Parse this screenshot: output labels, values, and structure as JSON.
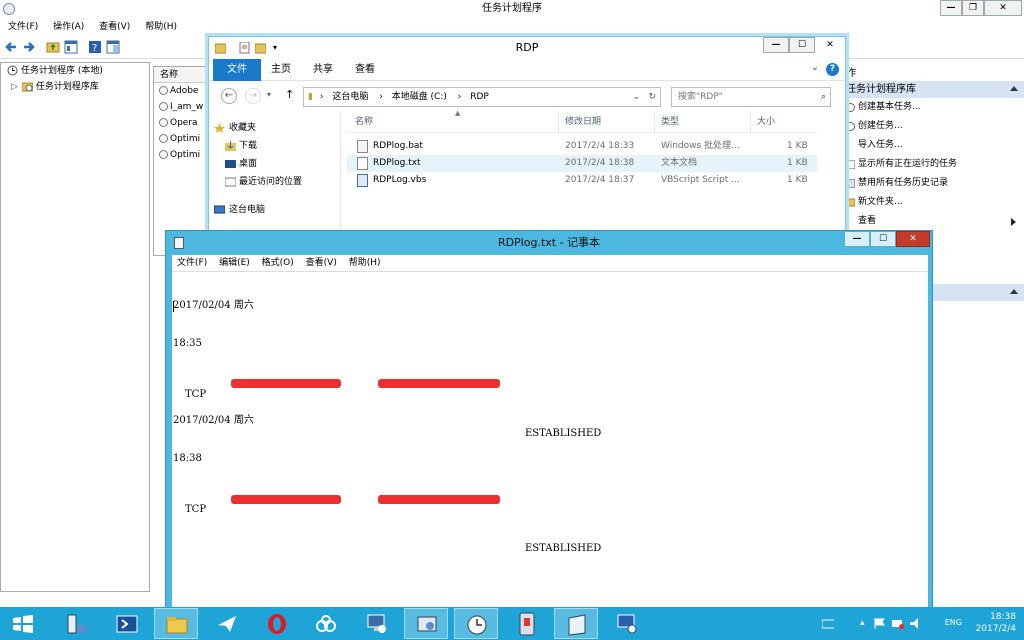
{
  "task_scheduler": {
    "title": "任务计划程序",
    "menu": [
      "文件(F)",
      "操作(A)",
      "查看(V)",
      "帮助(H)"
    ],
    "tree": {
      "root": "任务计划程序 (本地)",
      "library": "任务计划程序库"
    },
    "list": {
      "header": "名称",
      "items": [
        "Adobe",
        "I_am_w",
        "Opera",
        "Optimi",
        "Optimi"
      ]
    },
    "actions": {
      "header": "作",
      "section": "任务计划程序库",
      "items": [
        "创建基本任务...",
        "创建任务...",
        "导入任务...",
        "显示所有正在运行的任务",
        "禁用所有任务历史记录",
        "新文件夹...",
        "查看"
      ]
    }
  },
  "explorer": {
    "title": "RDP",
    "ribbon_tabs": [
      "文件",
      "主页",
      "共享",
      "查看"
    ],
    "address": [
      "这台电脑",
      "本地磁盘 (C:)",
      "RDP"
    ],
    "search_placeholder": "搜索\"RDP\"",
    "nav": [
      "收藏夹",
      "下载",
      "桌面",
      "最近访问的位置",
      "这台电脑"
    ],
    "columns": [
      "名称",
      "修改日期",
      "类型",
      "大小"
    ],
    "files": [
      {
        "name": "RDPlog.bat",
        "date": "2017/2/4 18:33",
        "type": "Windows 批处理...",
        "size": "1 KB"
      },
      {
        "name": "RDPlog.txt",
        "date": "2017/2/4 18:38",
        "type": "文本文档",
        "size": "1 KB"
      },
      {
        "name": "RDPLog.vbs",
        "date": "2017/2/4 18:37",
        "type": "VBScript Script ...",
        "size": "1 KB"
      }
    ]
  },
  "notepad": {
    "title": "RDPlog.txt - 记事本",
    "menu": [
      "文件(F)",
      "编辑(E)",
      "格式(O)",
      "查看(V)",
      "帮助(H)"
    ],
    "lines": [
      {
        "date": "2017/02/04 周六",
        "time": "18:35",
        "proto": "TCP",
        "state": "ESTABLISHED"
      },
      {
        "date": "2017/02/04 周六",
        "time": "18:38",
        "proto": "TCP",
        "state": "ESTABLISHED"
      }
    ]
  },
  "taskbar": {
    "lang": "ENG",
    "time": "18:38",
    "date": "2017/2/4"
  },
  "colors": {
    "taskbar": "#1fa4d8",
    "notepad_frame": "#4cb8e0",
    "explorer_file_tab": "#1979ca",
    "redaction": "#ee2f2f",
    "close_button": "#c43b2d"
  }
}
